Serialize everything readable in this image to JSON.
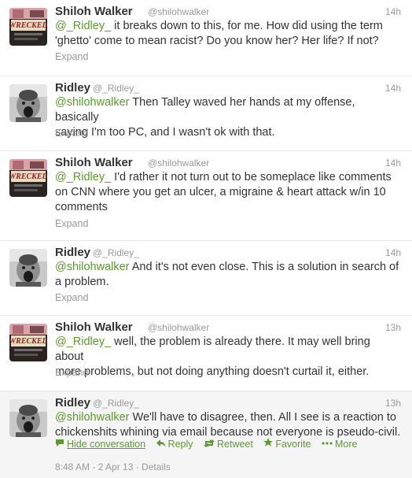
{
  "tweets": [
    {
      "fullname": "Shiloh Walker",
      "username": "@shilohwalker",
      "time": "14h",
      "avatar": "wrecked-book-cover",
      "line1_mention": "@_Ridley_",
      "line1_rest": " it breaks down to this, for me.  How did using the term",
      "line2": "'ghetto' come to mean racist?  Do you know her? Her life? If not?",
      "expand": "Expand"
    },
    {
      "fullname": "Ridley",
      "username": "@_Ridley_",
      "time": "14h",
      "avatar": "screaming-child-photo",
      "line1_mention": "@shilohwalker",
      "line1_rest": " Then Talley waved her hands at my offense, basically",
      "line2": "saying I'm too PC, and I wasn't ok with that.",
      "expand": "Expand"
    },
    {
      "fullname": "Shiloh Walker",
      "username": "@shilohwalker",
      "time": "14h",
      "avatar": "wrecked-book-cover",
      "line1_mention": "@_Ridley_",
      "line1_rest": " I'd rather it not turn out to be someplace like comments",
      "line2": "on CNN where you get an ulcer, a migraine & heart attack w/in 10",
      "line3": "comments",
      "expand": "Expand"
    },
    {
      "fullname": "Ridley",
      "username": "@_Ridley_",
      "time": "14h",
      "avatar": "screaming-child-photo",
      "line1_mention": "@shilohwalker",
      "line1_rest": " And it's not even close. This is a solution in search of",
      "line2": "a problem.",
      "expand": "Expand"
    },
    {
      "fullname": "Shiloh Walker",
      "username": "@shilohwalker",
      "time": "13h",
      "avatar": "wrecked-book-cover",
      "line1_mention": "@_Ridley_",
      "line1_rest": " well, the problem is already there.  It may well bring about",
      "line2": "more problems, but not doing anything doesn't curtail it, either.",
      "expand": "Expand"
    },
    {
      "fullname": "Ridley",
      "username": "@_Ridley_",
      "time": "13h",
      "avatar": "screaming-child-photo",
      "line1_mention": "@shilohwalker",
      "line1_rest": " We'll have to disagree, then. All I see is a reaction to",
      "line2": "chickenshits whining via email because not everyone is pseudo-civil.",
      "actions": {
        "hide": "Hide conversation",
        "reply": "Reply",
        "retweet": "Retweet",
        "favorite": "Favorite",
        "more": "More"
      },
      "meta": "8:48 AM - 2 Apr 13 · Details"
    }
  ],
  "avatar_cover_word": "WRECKED",
  "colors": {
    "link": "#5a9b2c",
    "muted": "#999999",
    "text": "#333333",
    "expanded_bg": "#f5f5f5",
    "divider": "#e8e8e8"
  }
}
